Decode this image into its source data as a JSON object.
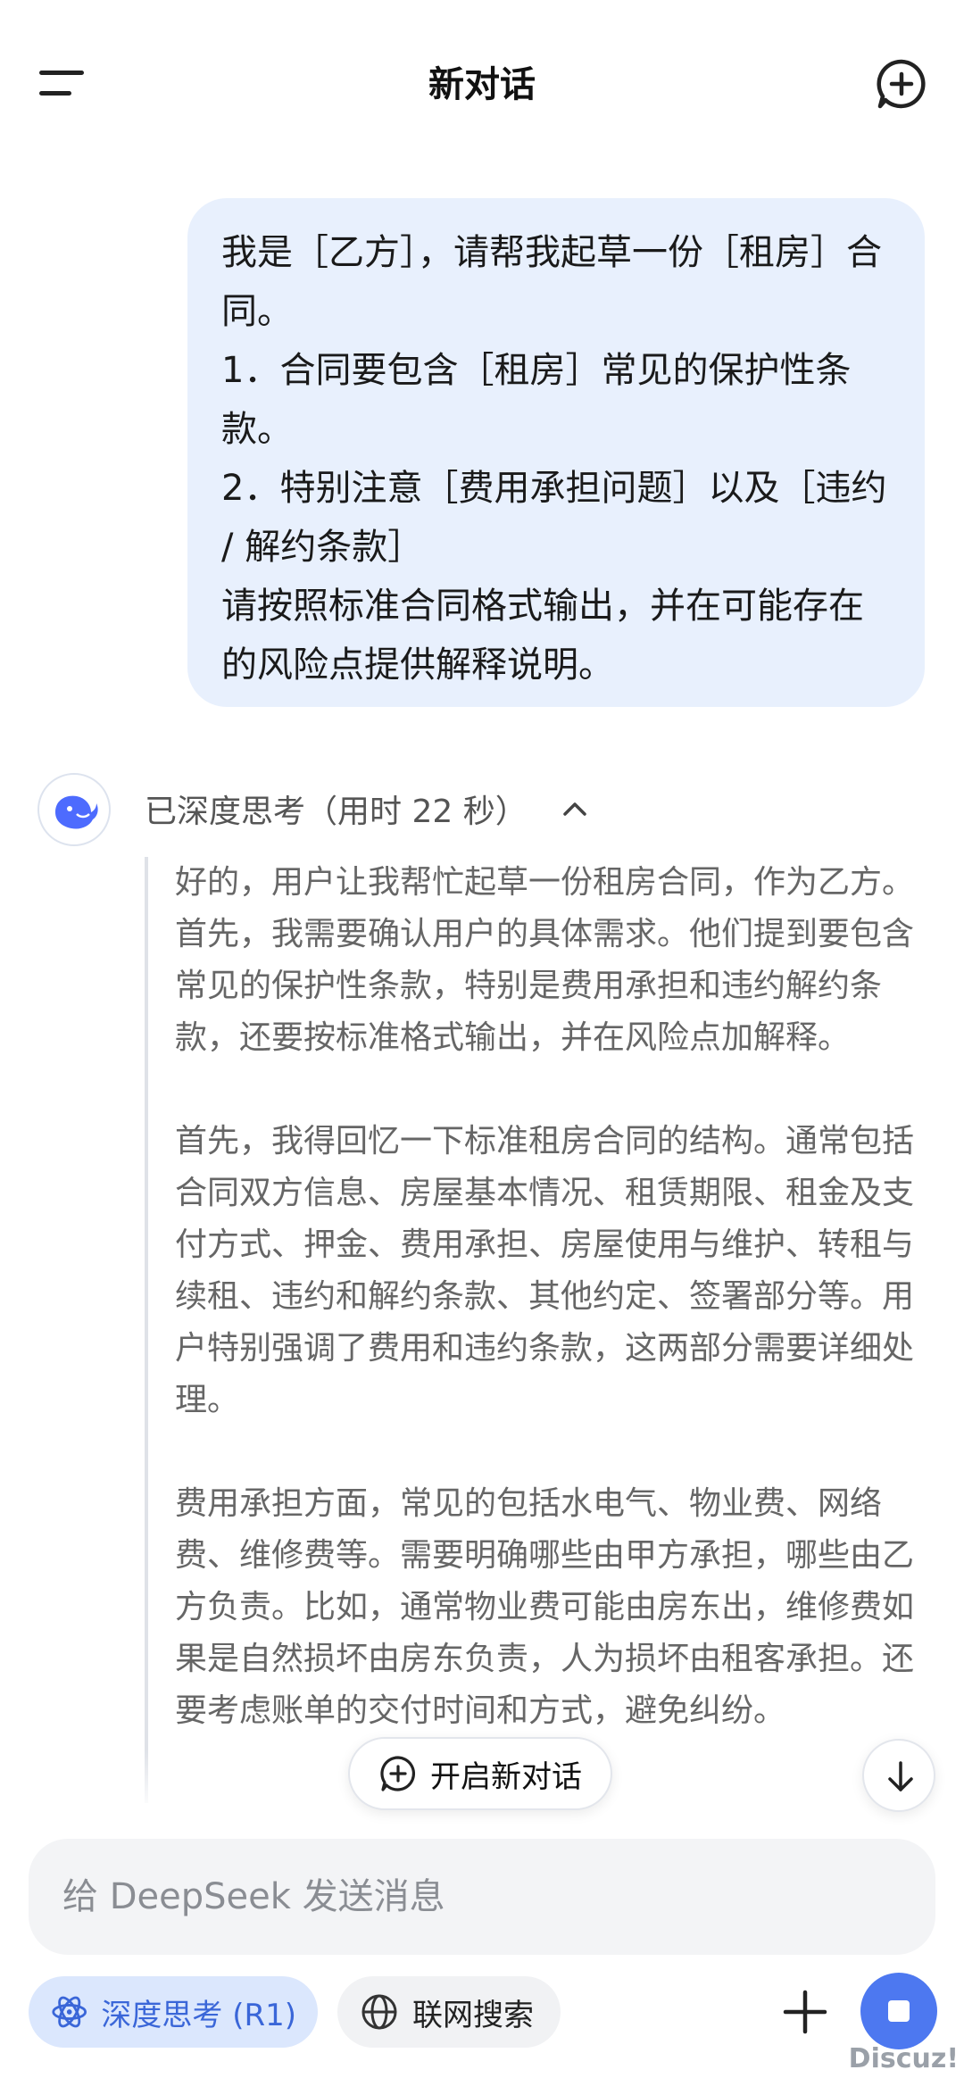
{
  "header": {
    "title": "新对话",
    "menu_icon": "hamburger-menu-icon",
    "new_chat_icon": "chat-plus-icon"
  },
  "user_message": {
    "text": "我是［乙方］，请帮我起草一份［租房］合同。\n1．合同要包含［租房］常见的保护性条款。\n2．特别注意［费用承担问题］以及［违约 / 解约条款］\n请按照标准合同格式输出，并在可能存在的风险点提供解释说明。"
  },
  "assistant": {
    "avatar_icon": "deepseek-whale-icon",
    "thinking_label": "已深度思考（用时 22 秒）",
    "thinking_paragraphs": [
      "好的，用户让我帮忙起草一份租房合同，作为乙方。首先，我需要确认用户的具体需求。他们提到要包含常见的保护性条款，特别是费用承担和违约解约条款，还要按标准格式输出，并在风险点加解释。",
      "首先，我得回忆一下标准租房合同的结构。通常包括合同双方信息、房屋基本情况、租赁期限、租金及支付方式、押金、费用承担、房屋使用与维护、转租与续租、违约和解约条款、其他约定、签署部分等。用户特别强调了费用和违约条款，这两部分需要详细处理。",
      "费用承担方面，常见的包括水电气、物业费、网络费、维修费等。需要明确哪些由甲方承担，哪些由乙方负责。比如，通常物业费可能由房东出，维修费如果是自然损坏由房东负责，人为损坏由租客承担。还要考虑账单的交付时间和方式，避免纠纷。"
    ]
  },
  "floating": {
    "new_chat_label": "开启新对话",
    "scroll_down_icon": "arrow-down-icon"
  },
  "composer": {
    "placeholder": "给 DeepSeek 发送消息",
    "value": ""
  },
  "toolbar": {
    "deep_think_label": "深度思考 (R1)",
    "web_search_label": "联网搜索",
    "plus_icon": "plus-icon",
    "stop_icon": "stop-icon",
    "accent_color": "#4d78f0",
    "deep_think_bg": "#dbe7fd"
  },
  "watermark": "Discuz!"
}
